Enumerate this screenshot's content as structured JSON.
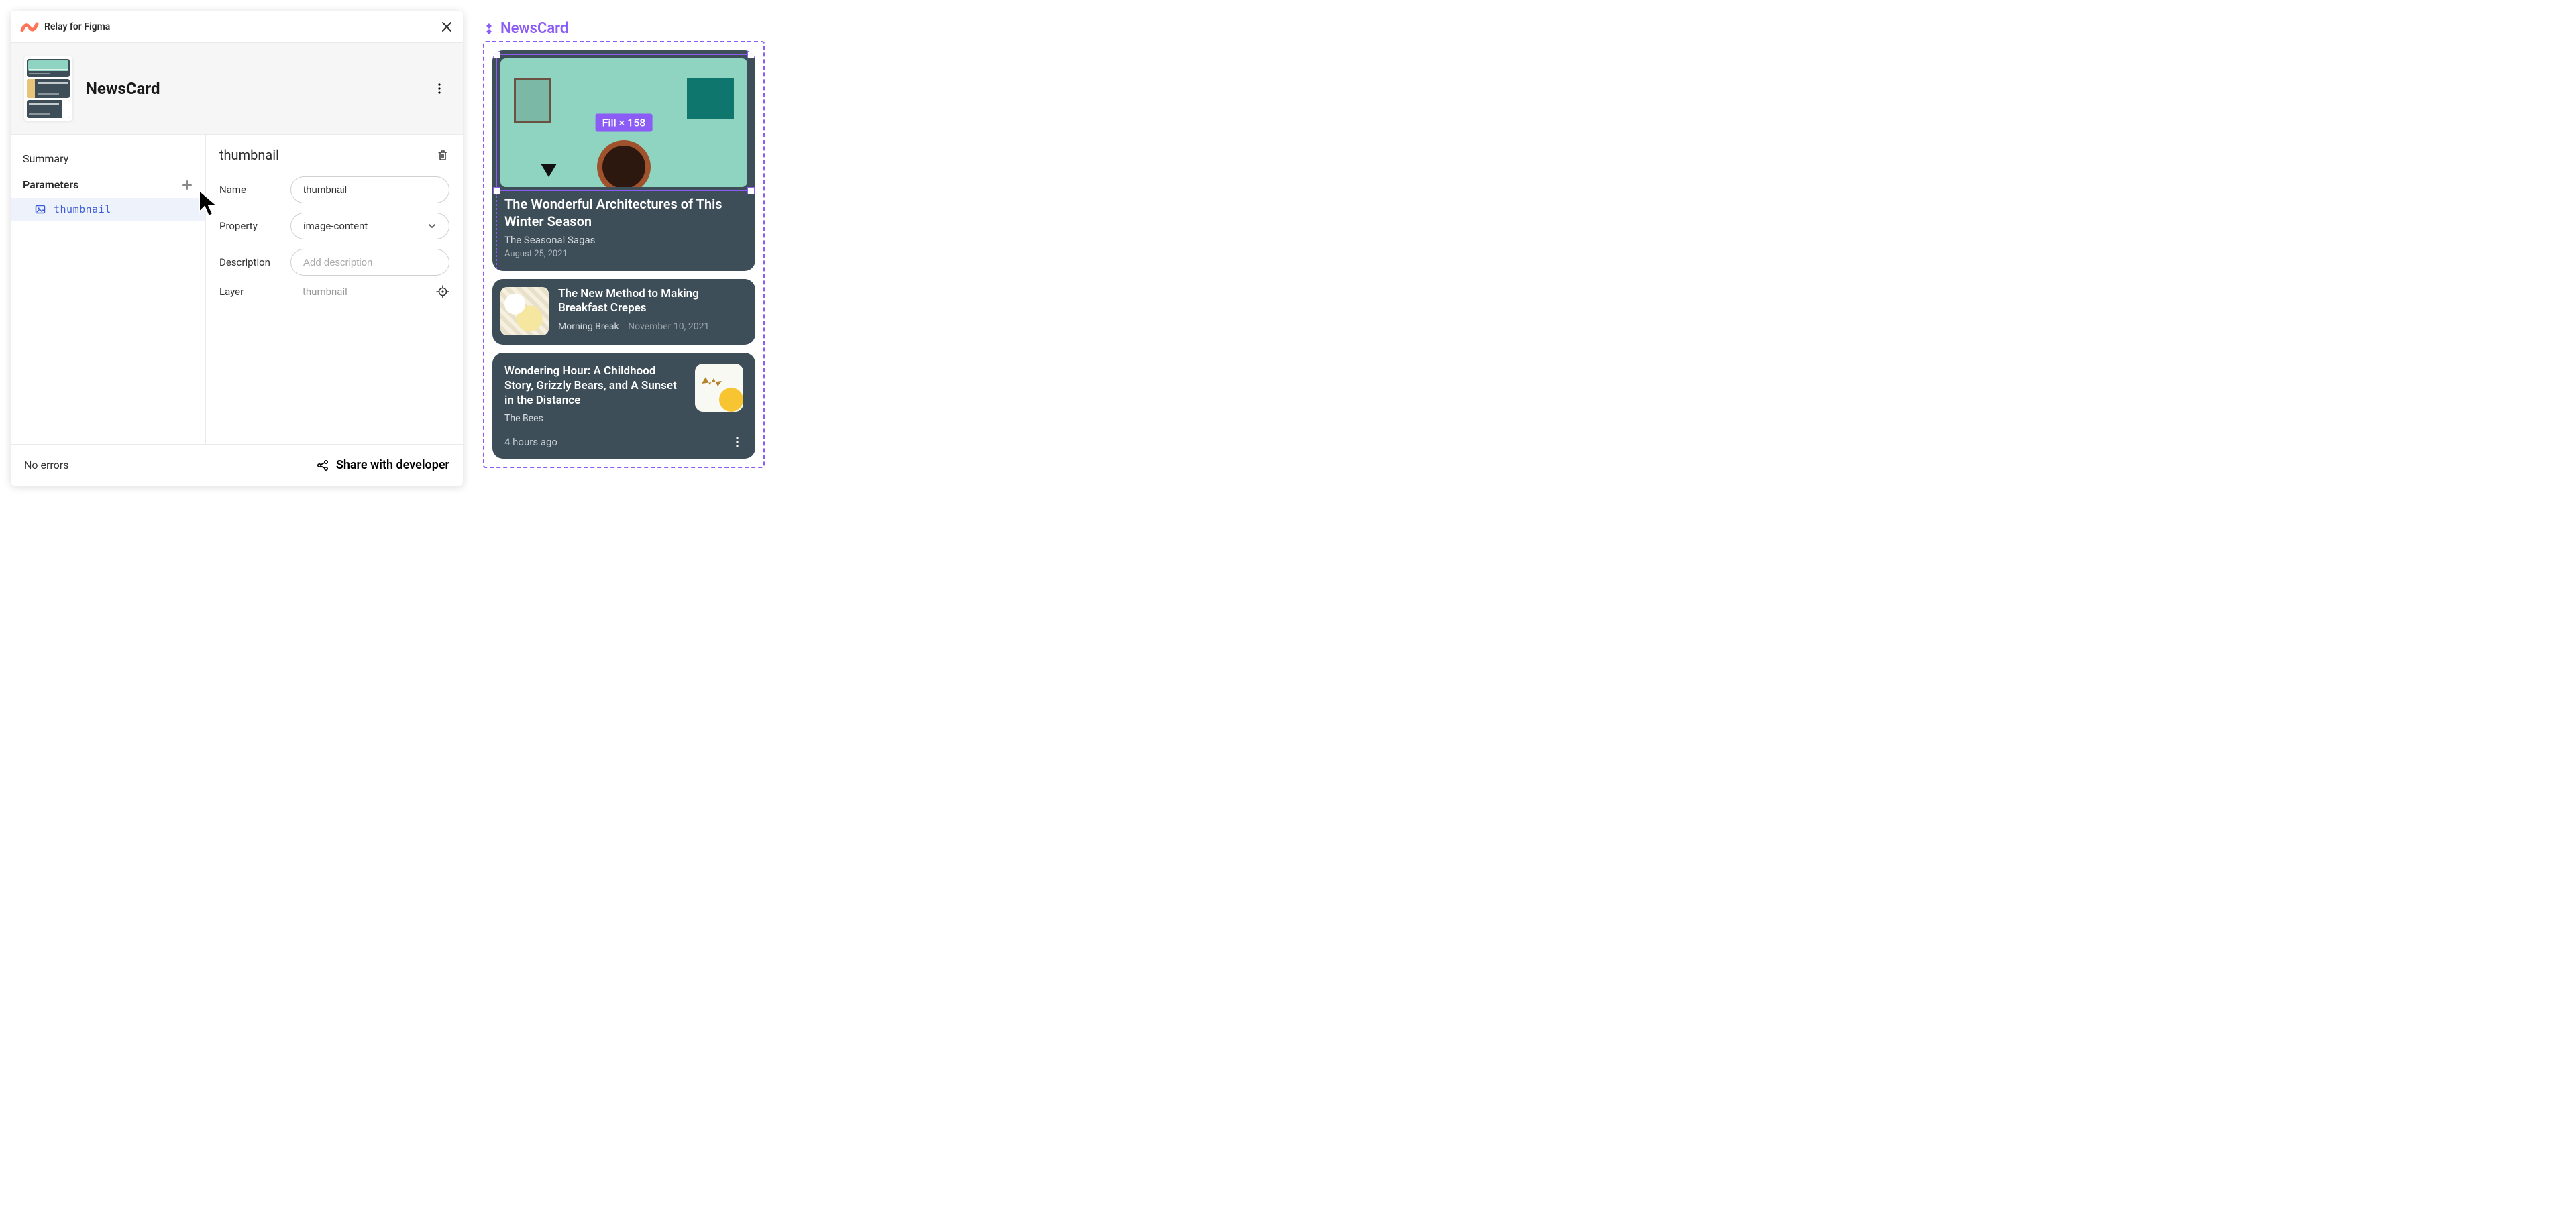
{
  "plugin": {
    "title": "Relay for Figma"
  },
  "component": {
    "name": "NewsCard"
  },
  "sidebar": {
    "summary_label": "Summary",
    "parameters_label": "Parameters",
    "items": [
      {
        "label": "thumbnail"
      }
    ]
  },
  "detail": {
    "title": "thumbnail",
    "rows": {
      "name_label": "Name",
      "name_value": "thumbnail",
      "property_label": "Property",
      "property_value": "image-content",
      "description_label": "Description",
      "description_placeholder": "Add description",
      "layer_label": "Layer",
      "layer_value": "thumbnail"
    }
  },
  "footer": {
    "errors": "No errors",
    "share": "Share with developer"
  },
  "figma": {
    "component_label": "NewsCard",
    "selection_badge": "Fill × 158",
    "cards": {
      "hero": {
        "title": "The Wonderful Architectures of This Winter Season",
        "subtitle": "The Seasonal Sagas",
        "date": "August 25, 2021"
      },
      "list": {
        "title": "The New Method to Making Breakfast Crepes",
        "source": "Morning Break",
        "date": "November 10, 2021"
      },
      "story": {
        "title": "Wondering Hour: A Childhood Story, Grizzly Bears, and A Sunset in the Distance",
        "source": "The Bees",
        "ago": "4 hours ago"
      }
    }
  }
}
